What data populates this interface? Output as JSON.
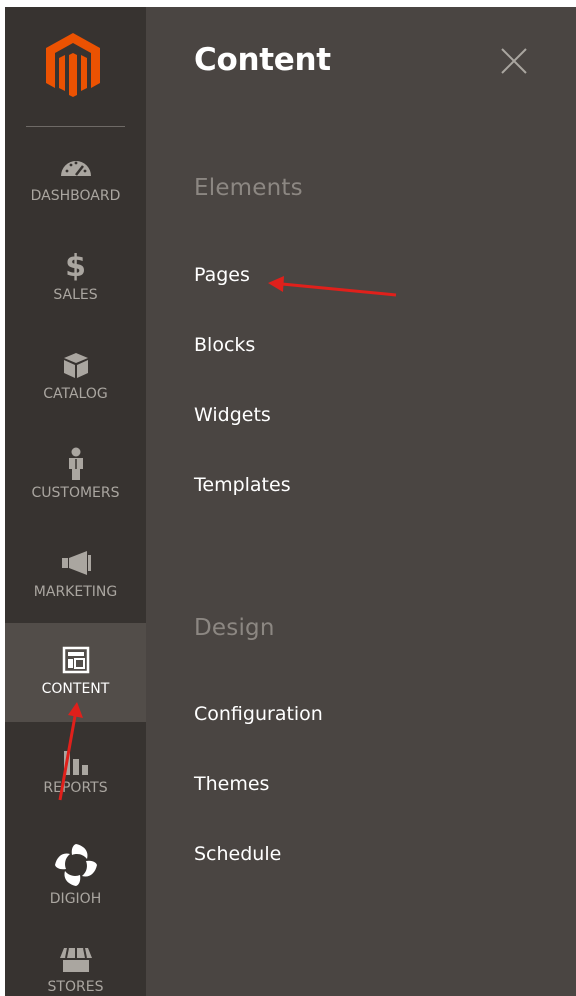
{
  "sidebar": {
    "logo": "magento-logo",
    "items": [
      {
        "label": "DASHBOARD",
        "icon": "dashboard-gauge-icon"
      },
      {
        "label": "SALES",
        "icon": "dollar-icon"
      },
      {
        "label": "CATALOG",
        "icon": "box-icon"
      },
      {
        "label": "CUSTOMERS",
        "icon": "person-icon"
      },
      {
        "label": "MARKETING",
        "icon": "megaphone-icon"
      },
      {
        "label": "CONTENT",
        "icon": "layout-icon",
        "active": true
      },
      {
        "label": "REPORTS",
        "icon": "bar-chart-icon"
      },
      {
        "label": "DIGIOH",
        "icon": "digioh-logo-icon"
      },
      {
        "label": "STORES",
        "icon": "storefront-icon"
      }
    ]
  },
  "panel": {
    "title": "Content",
    "close_icon": "close-icon",
    "sections": [
      {
        "title": "Elements",
        "links": [
          "Pages",
          "Blocks",
          "Widgets",
          "Templates"
        ]
      },
      {
        "title": "Design",
        "links": [
          "Configuration",
          "Themes",
          "Schedule"
        ]
      }
    ]
  },
  "colors": {
    "sidebar_bg": "#373330",
    "panel_bg": "#4a4542",
    "active_bg": "#524d49",
    "logo_orange": "#eb5202",
    "annotation_red": "#e0201b"
  }
}
